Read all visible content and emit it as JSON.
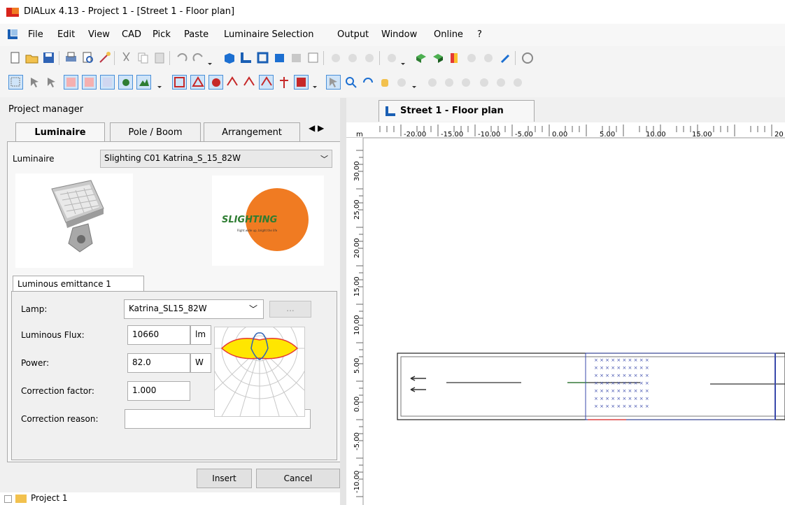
{
  "window": {
    "title": "DIALux 4.13 - Project 1 - [Street 1 - Floor plan]"
  },
  "menu": [
    "File",
    "Edit",
    "View",
    "CAD",
    "Pick",
    "Paste",
    "Luminaire Selection",
    "Output",
    "Window",
    "Online",
    "?"
  ],
  "project_manager": {
    "header": "Project manager",
    "tabs": [
      "Luminaire",
      "Pole / Boom",
      "Arrangement"
    ],
    "tab_scroll": "◀ ▶",
    "luminaire_label": "Luminaire",
    "luminaire_selected": "Slighting C01 Katrina_S_15_82W",
    "logo_text": "SLIGHTING",
    "logo_tagline": "Right wide up, bright the life",
    "emittance_tab": "Luminous emittance 1",
    "fields": {
      "lamp_label": "Lamp:",
      "lamp_value": "Katrina_SL15_82W",
      "dots": "...",
      "flux_label": "Luminous Flux:",
      "flux_value": "10660",
      "flux_unit": "lm",
      "power_label": "Power:",
      "power_value": "82.0",
      "power_unit": "W",
      "cf_label": "Correction factor:",
      "cf_value": "1.000",
      "reason_label": "Correction reason:",
      "reason_value": ""
    },
    "insert": "Insert",
    "cancel": "Cancel",
    "tree_item": "Project 1"
  },
  "view": {
    "tab_label": "Street 1 - Floor plan",
    "ruler_unit": "m",
    "h_ticks": [
      "-20.00",
      "-15.00",
      "-10.00",
      "-5.00",
      "0.00",
      "5.00",
      "10.00",
      "15.00",
      "20"
    ],
    "v_ticks": [
      "30.00",
      "25.00",
      "20.00",
      "15.00",
      "10.00",
      "5.00",
      "0.00",
      "-5.00",
      "-10.00"
    ]
  },
  "colors": {
    "logo_orange": "#f07b22",
    "accent_red": "#d8241b",
    "ldc_yellow": "#ffe600"
  }
}
